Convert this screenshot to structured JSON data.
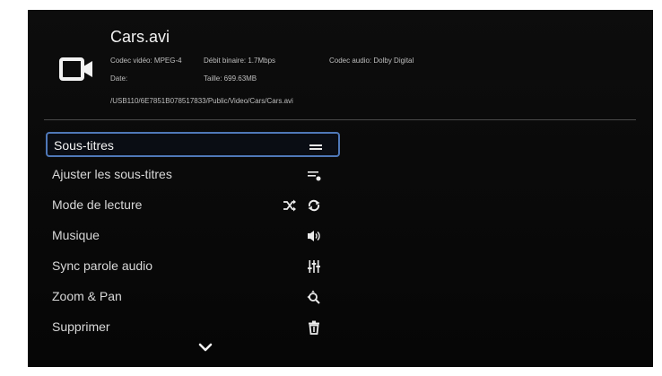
{
  "file": {
    "title": "Cars.avi",
    "icon": "video-camera-icon",
    "video_codec": "Codec vidéo: MPEG-4",
    "bitrate": "Débit binaire: 1.7Mbps",
    "audio_codec": "Codec audio: Dolby Digital",
    "date": "Date:",
    "size": "Taille: 699.63MB",
    "path": "/USB110/6E7851B078517833/Public/Video/Cars/Cars.avi"
  },
  "menu": {
    "items": [
      {
        "label": "Sous-titres",
        "icon": "subtitles-icon",
        "selected": true
      },
      {
        "label": "Ajuster les sous-titres",
        "icon": "subtitle-adjust-icon"
      },
      {
        "label": "Mode de lecture",
        "icon": "shuffle-repeat-icon"
      },
      {
        "label": "Musique",
        "icon": "speaker-icon"
      },
      {
        "label": "Sync parole audio",
        "icon": "equalizer-sliders-icon"
      },
      {
        "label": "Zoom & Pan",
        "icon": "zoom-icon"
      },
      {
        "label": "Supprimer",
        "icon": "trash-icon"
      }
    ],
    "more_icon": "chevron-down-icon"
  },
  "colors": {
    "background": "#0a0a0a",
    "selection_border": "#4f78b8",
    "text": "#d8d8d8"
  }
}
